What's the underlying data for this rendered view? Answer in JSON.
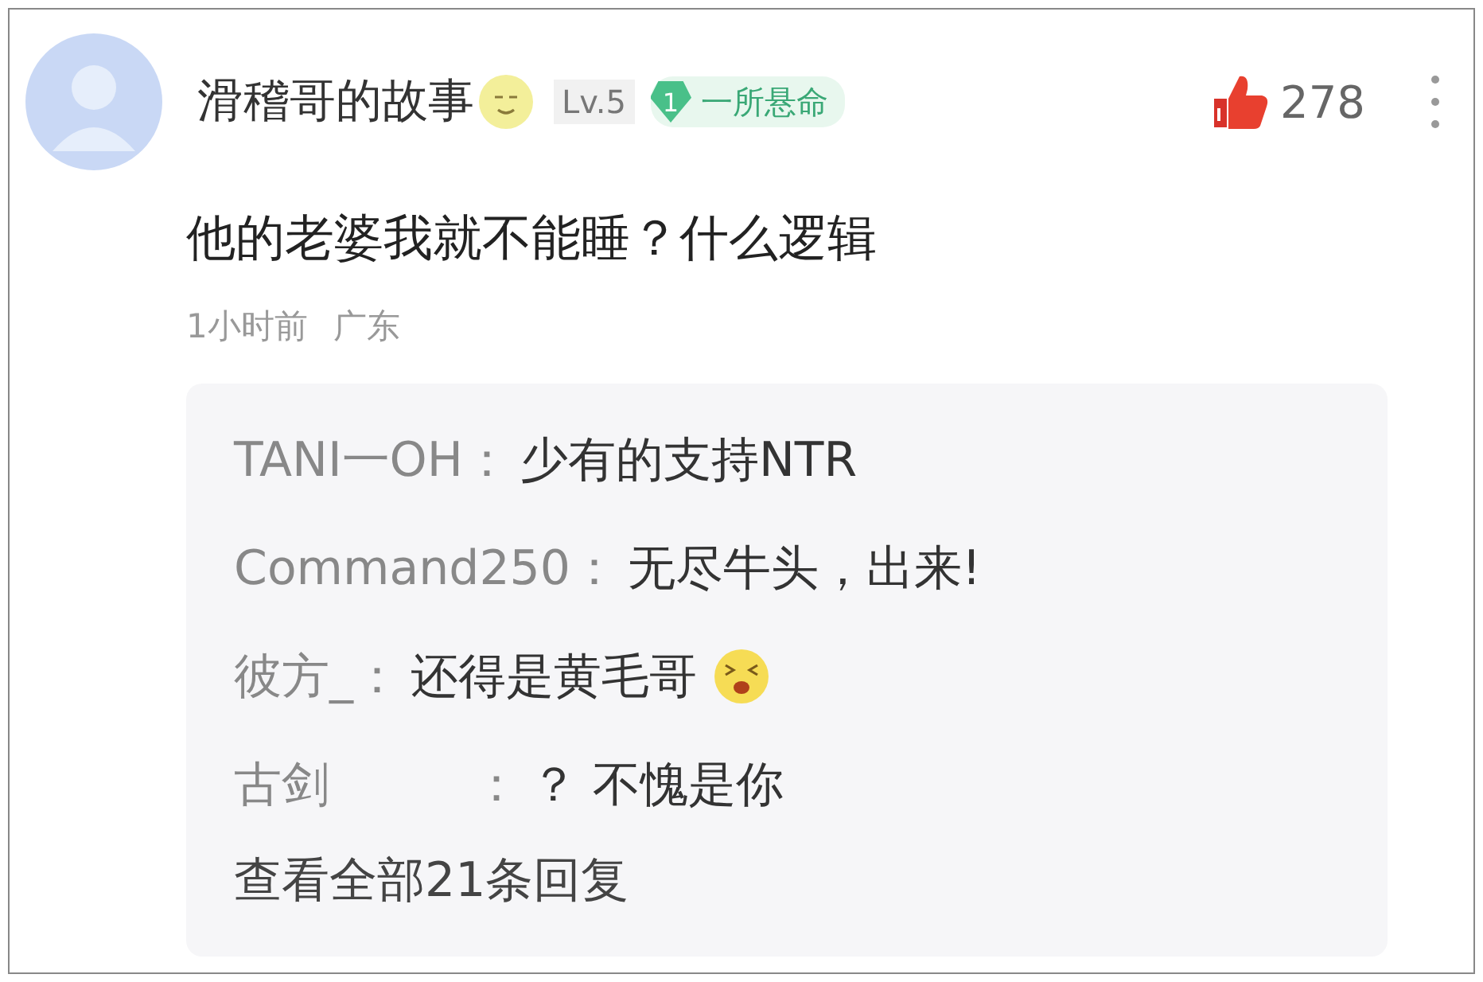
{
  "comment": {
    "author": "滑稽哥的故事",
    "level": "Lv.5",
    "badge": {
      "number": "1",
      "title": "一所悬命"
    },
    "likes": "278",
    "text": "他的老婆我就不能睡？什么逻辑",
    "time": "1小时前",
    "location": "广东"
  },
  "replies": [
    {
      "name": "TANI一OH：",
      "text": "少有的支持NTR"
    },
    {
      "name": "Command250：",
      "text": "无尽牛头，出来!"
    },
    {
      "name": "彼方_：",
      "text": "还得是黄毛哥",
      "emoji": {
        "kind": "laughing"
      }
    },
    {
      "name": "古剑　　　：",
      "text": "？ 不愧是你"
    }
  ],
  "more_replies": "查看全部21条回复"
}
